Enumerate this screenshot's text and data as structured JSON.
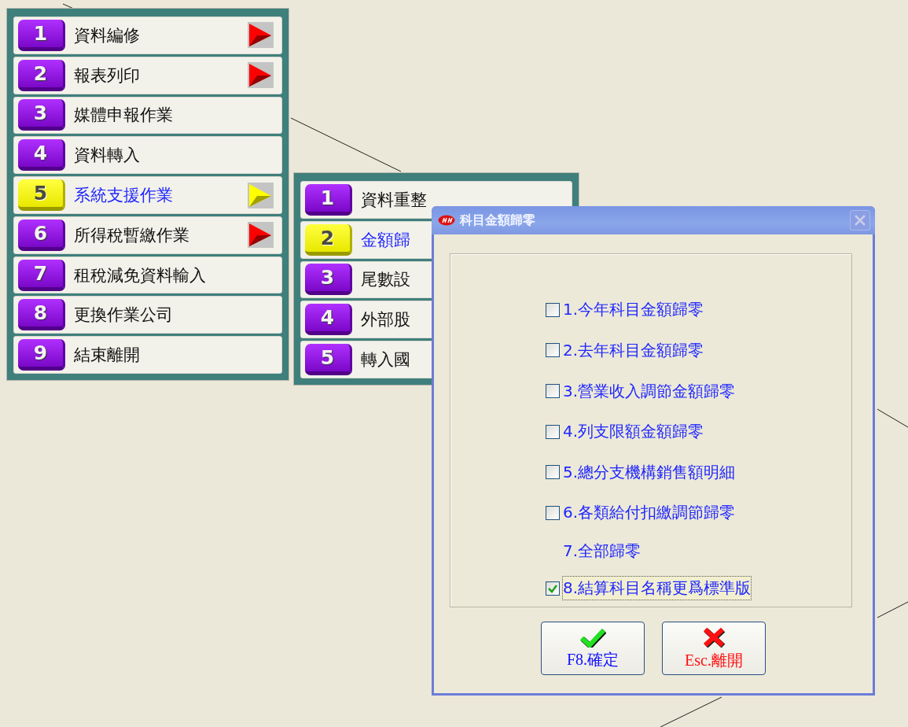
{
  "main_menu": {
    "items": [
      {
        "number": "1",
        "label": "資料編修",
        "selected": false,
        "submenu": true
      },
      {
        "number": "2",
        "label": "報表列印",
        "selected": false,
        "submenu": true
      },
      {
        "number": "3",
        "label": "媒體申報作業",
        "selected": false,
        "submenu": false
      },
      {
        "number": "4",
        "label": "資料轉入",
        "selected": false,
        "submenu": false
      },
      {
        "number": "5",
        "label": "系統支援作業",
        "selected": true,
        "submenu": true
      },
      {
        "number": "6",
        "label": "所得稅暫繳作業",
        "selected": false,
        "submenu": true
      },
      {
        "number": "7",
        "label": "租稅減免資料輸入",
        "selected": false,
        "submenu": false
      },
      {
        "number": "8",
        "label": "更換作業公司",
        "selected": false,
        "submenu": false
      },
      {
        "number": "9",
        "label": "結束離開",
        "selected": false,
        "submenu": false
      }
    ]
  },
  "submenu": {
    "items": [
      {
        "number": "1",
        "label": "資料重整",
        "selected": false
      },
      {
        "number": "2",
        "label": "金額歸",
        "selected": true
      },
      {
        "number": "3",
        "label": "尾數設",
        "selected": false
      },
      {
        "number": "4",
        "label": "外部股",
        "selected": false
      },
      {
        "number": "5",
        "label": "轉入國",
        "selected": false
      }
    ]
  },
  "dialog": {
    "title": "科目金額歸零",
    "close_disabled": true,
    "options": [
      {
        "kind": "checkbox",
        "label": "1.今年科目金額歸零",
        "checked": false,
        "focused": false
      },
      {
        "kind": "checkbox",
        "label": "2.去年科目金額歸零",
        "checked": false,
        "focused": false
      },
      {
        "kind": "checkbox",
        "label": "3.營業收入調節金額歸零",
        "checked": false,
        "focused": false
      },
      {
        "kind": "checkbox",
        "label": "4.列支限額金額歸零",
        "checked": false,
        "focused": false
      },
      {
        "kind": "checkbox",
        "label": "5.總分支機構銷售額明細",
        "checked": false,
        "focused": false
      },
      {
        "kind": "checkbox",
        "label": "6.各類給付扣繳調節歸零",
        "checked": false,
        "focused": false
      },
      {
        "kind": "label",
        "label": "7.全部歸零"
      },
      {
        "kind": "checkbox",
        "label": "8.結算科目名稱更爲標準版",
        "checked": true,
        "focused": true
      }
    ],
    "buttons": [
      {
        "kind": "ok",
        "label": "F8.確定"
      },
      {
        "kind": "cancel",
        "label": "Esc.離開"
      }
    ]
  }
}
